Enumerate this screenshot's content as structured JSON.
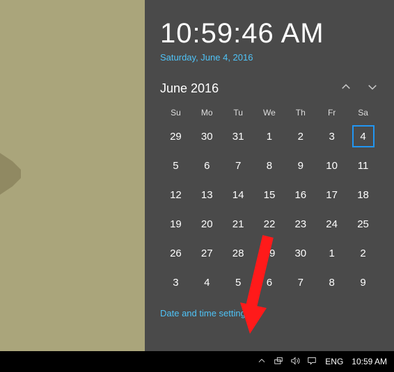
{
  "clock": {
    "time": "10:59:46 AM",
    "date_long": "Saturday, June 4, 2016"
  },
  "calendar": {
    "month_label": "June 2016",
    "weekdays": [
      "Su",
      "Mo",
      "Tu",
      "We",
      "Th",
      "Fr",
      "Sa"
    ],
    "cells": [
      {
        "d": "29",
        "other": true
      },
      {
        "d": "30",
        "other": true
      },
      {
        "d": "31",
        "other": true
      },
      {
        "d": "1"
      },
      {
        "d": "2"
      },
      {
        "d": "3"
      },
      {
        "d": "4",
        "today": true
      },
      {
        "d": "5"
      },
      {
        "d": "6"
      },
      {
        "d": "7"
      },
      {
        "d": "8"
      },
      {
        "d": "9"
      },
      {
        "d": "10"
      },
      {
        "d": "11"
      },
      {
        "d": "12"
      },
      {
        "d": "13"
      },
      {
        "d": "14"
      },
      {
        "d": "15"
      },
      {
        "d": "16"
      },
      {
        "d": "17"
      },
      {
        "d": "18"
      },
      {
        "d": "19"
      },
      {
        "d": "20"
      },
      {
        "d": "21"
      },
      {
        "d": "22"
      },
      {
        "d": "23"
      },
      {
        "d": "24"
      },
      {
        "d": "25"
      },
      {
        "d": "26"
      },
      {
        "d": "27"
      },
      {
        "d": "28"
      },
      {
        "d": "29"
      },
      {
        "d": "30"
      },
      {
        "d": "1",
        "other": true
      },
      {
        "d": "2",
        "other": true
      },
      {
        "d": "3",
        "other": true
      },
      {
        "d": "4",
        "other": true
      },
      {
        "d": "5",
        "other": true
      },
      {
        "d": "6",
        "other": true
      },
      {
        "d": "7",
        "other": true
      },
      {
        "d": "8",
        "other": true
      },
      {
        "d": "9",
        "other": true
      }
    ]
  },
  "links": {
    "settings": "Date and time settings"
  },
  "taskbar": {
    "language": "ENG",
    "clock": "10:59 AM"
  }
}
